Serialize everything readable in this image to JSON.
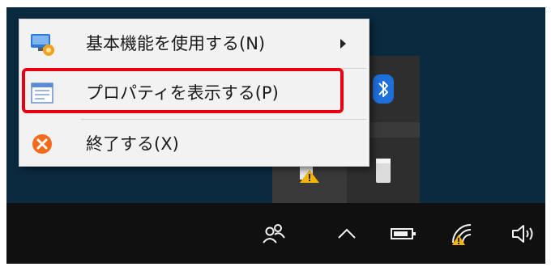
{
  "context_menu": {
    "items": [
      {
        "label": "基本機能を使用する(N)",
        "icon": "monitor-app-icon",
        "has_submenu": true
      },
      {
        "label": "プロパティを表示する(P)",
        "icon": "properties-window-icon",
        "has_submenu": false
      },
      {
        "label": "終了する(X)",
        "icon": "exit-icon",
        "has_submenu": false
      }
    ],
    "highlighted_item": "プロパティを表示する(P)"
  },
  "tray_overflow": {
    "icons": [
      "bluetooth-icon",
      "warning-app-icon",
      "usb-drive-icon"
    ]
  },
  "taskbar": {
    "icons": [
      "people-icon",
      "show-hidden-icons-chevron",
      "battery-icon",
      "wifi-warning-icon",
      "volume-icon"
    ]
  },
  "colors": {
    "highlight_border": "#e60012",
    "bluetooth_blue": "#1e6fd9",
    "exit_orange": "#f26b1d",
    "desktop": "#0a2a40",
    "taskbar": "#101010"
  }
}
